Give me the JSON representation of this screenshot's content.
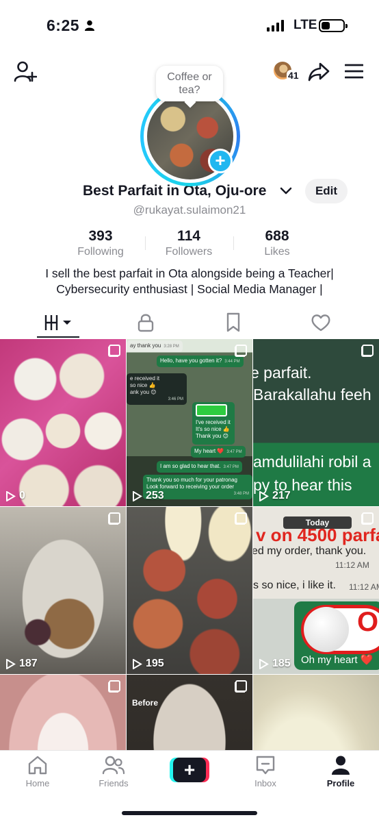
{
  "status_bar": {
    "time": "6:25",
    "network": "LTE",
    "icons": [
      "person-icon",
      "signal-icon",
      "battery-icon"
    ]
  },
  "top_bar": {
    "viewer_count": "41",
    "icons": [
      "add-friend-icon",
      "share-icon",
      "menu-icon"
    ]
  },
  "profile": {
    "note_bubble": "Coffee or tea?",
    "display_name": "Best Parfait in Ota, Oju-ore",
    "username": "@rukayat.sulaimon21",
    "edit_label": "Edit",
    "stats": [
      {
        "value": "393",
        "label": "Following"
      },
      {
        "value": "114",
        "label": "Followers"
      },
      {
        "value": "688",
        "label": "Likes"
      }
    ],
    "bio_line1": "I sell the best parfait in Ota alongside being a Teacher|",
    "bio_line2": "Cybersecurity enthusiast | Social Media Manager |",
    "accent_color": "#20b7f0"
  },
  "tabs": [
    "videos-grid-icon",
    "private-lock-icon",
    "saved-bookmark-icon",
    "liked-heart-icon"
  ],
  "grid": {
    "views": [
      "0",
      "253",
      "217",
      "187",
      "195",
      "185"
    ],
    "chat1": {
      "top": "ay thank you",
      "top_ts": "3:28 PM",
      "q": "Hello, have you gotten it?",
      "q_ts": "3:44 PM",
      "r1": "e received it",
      "r2": "so nice 👍",
      "r3": "ank you 😊",
      "r_ts": "3:46 PM",
      "quote1": "I've received it",
      "quote2": "It's so nice 👍",
      "quote3": "Thank you 😊",
      "heart": "My heart ❤️",
      "heart_ts": "3:47 PM",
      "glad": "I am so glad to hear that.",
      "glad_ts": "3:47 PM",
      "thanks1": "Thank you so much for your patronag",
      "thanks2": "Look forward to receiving your order",
      "thanks_ts": "3:48 PM"
    },
    "chat2": {
      "l1": "e parfait.",
      "l2": "Barakallahu feeh",
      "l3": "amdulilahi robil a",
      "l4": "py to hear this"
    },
    "chat3": {
      "today": "Today",
      "promo": "v on 4500 parfa",
      "l1": "ed my order, thank you.",
      "ts1": "11:12 AM",
      "l2": "s so nice, i like it.",
      "ts2": "11:12 AM",
      "heart": "Oh my heart ❤️"
    },
    "before_label": "Before"
  },
  "bottom_nav": [
    {
      "label": "Home",
      "icon": "home-icon"
    },
    {
      "label": "Friends",
      "icon": "friends-icon"
    },
    {
      "label": "Inbox",
      "icon": "inbox-icon"
    },
    {
      "label": "Profile",
      "icon": "profile-icon"
    }
  ]
}
